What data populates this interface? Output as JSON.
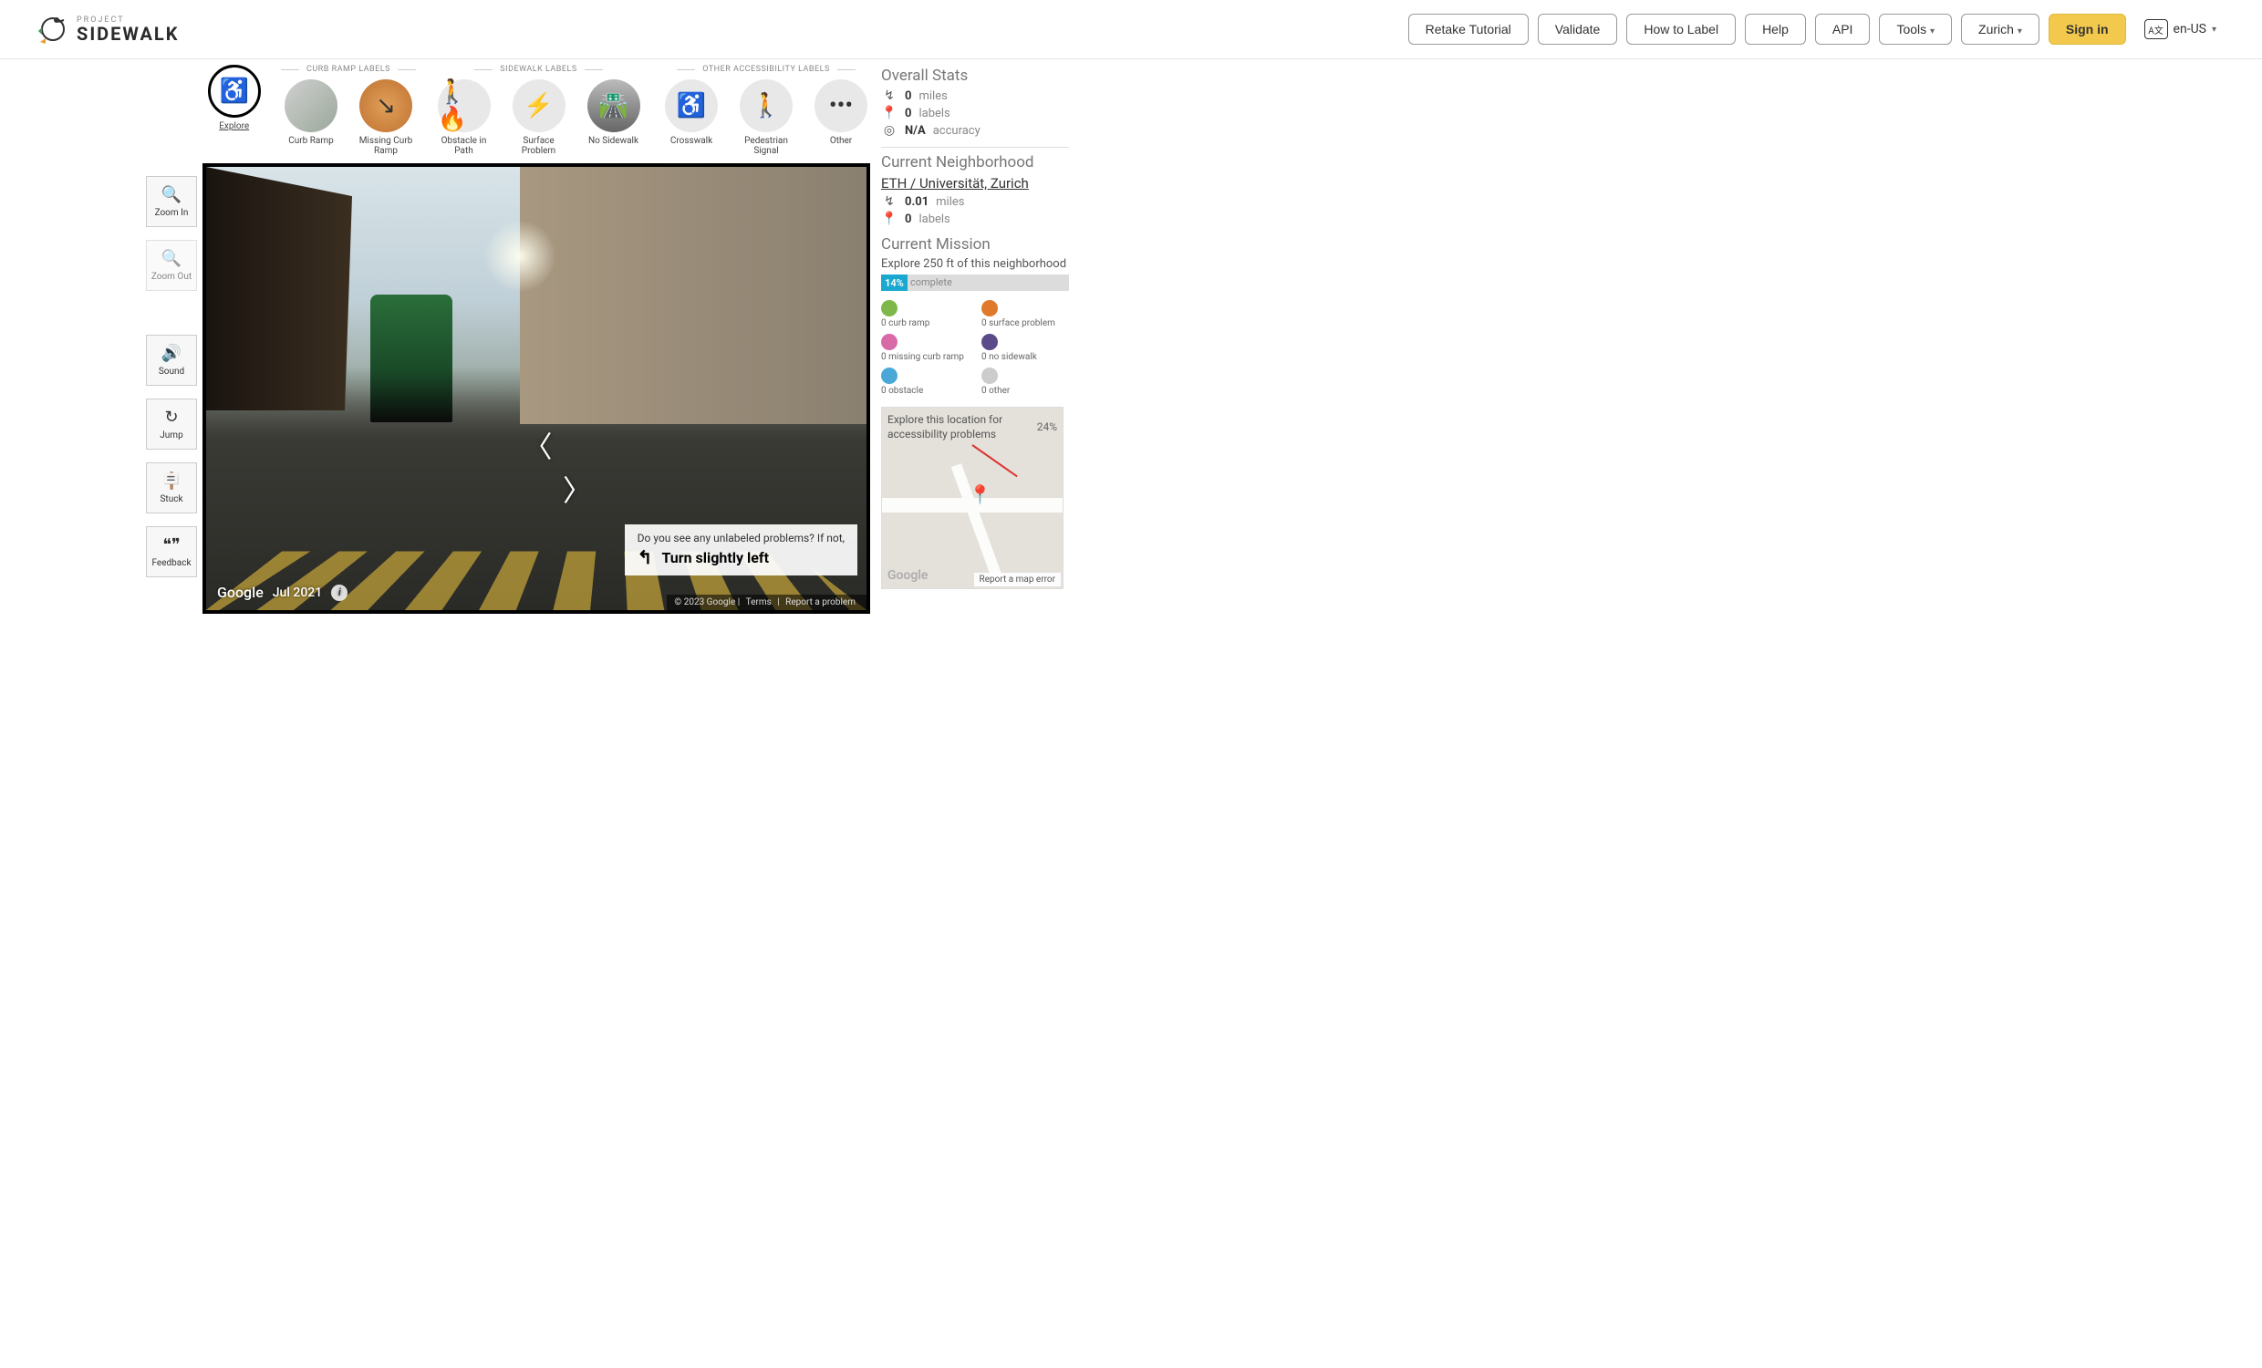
{
  "brand": {
    "project": "PROJECT",
    "name": "SIDEWALK"
  },
  "nav": {
    "retake": "Retake Tutorial",
    "validate": "Validate",
    "howto": "How to Label",
    "help": "Help",
    "api": "API",
    "tools": "Tools",
    "city": "Zurich",
    "signin": "Sign in",
    "language": "en-US"
  },
  "left_tools": {
    "zoom_in": "Zoom In",
    "zoom_out": "Zoom Out",
    "sound": "Sound",
    "jump": "Jump",
    "stuck": "Stuck",
    "feedback": "Feedback"
  },
  "label_groups": {
    "curb": "CURB RAMP LABELS",
    "sidewalk": "SIDEWALK LABELS",
    "other": "OTHER ACCESSIBILITY LABELS"
  },
  "labels": {
    "explore": "Explore",
    "curb_ramp": "Curb Ramp",
    "missing_curb": "Missing Curb Ramp",
    "obstacle": "Obstacle in Path",
    "surface": "Surface Problem",
    "no_sidewalk": "No Sidewalk",
    "crosswalk": "Crosswalk",
    "ped_signal": "Pedestrian Signal",
    "other": "Other"
  },
  "streetview": {
    "prompt_q": "Do you see any unlabeled problems? If not,",
    "prompt_action": "Turn slightly left",
    "attribution": "Google",
    "date": "Jul 2021",
    "footer_copy": "© 2023 Google",
    "footer_terms": "Terms",
    "footer_report": "Report a problem"
  },
  "stats": {
    "overall_title": "Overall Stats",
    "overall_miles": "0",
    "overall_miles_unit": "miles",
    "overall_labels": "0",
    "overall_labels_unit": "labels",
    "overall_accuracy": "N/A",
    "overall_accuracy_unit": "accuracy",
    "neigh_title": "Current Neighborhood",
    "neigh_name": "ETH / Universität, Zurich",
    "neigh_miles": "0.01",
    "neigh_miles_unit": "miles",
    "neigh_labels": "0",
    "neigh_labels_unit": "labels",
    "mission_title": "Current Mission",
    "mission_desc": "Explore 250 ft of this neighborhood",
    "mission_pct": "14%",
    "mission_complete": "complete"
  },
  "legend": {
    "curb_ramp": "0 curb ramp",
    "surface": "0 surface problem",
    "missing_curb": "0 missing curb ramp",
    "no_sidewalk": "0 no sidewalk",
    "obstacle": "0 obstacle",
    "other": "0 other"
  },
  "legend_colors": {
    "curb_ramp": "#7fb84a",
    "surface": "#e07a2a",
    "missing_curb": "#d96aa8",
    "no_sidewalk": "#5a4a8a",
    "obstacle": "#4aa8d8",
    "other": "#cccccc"
  },
  "minimap": {
    "hint": "Explore this location for accessibility problems",
    "pct": "24%",
    "google": "Google",
    "report": "Report a map error"
  }
}
